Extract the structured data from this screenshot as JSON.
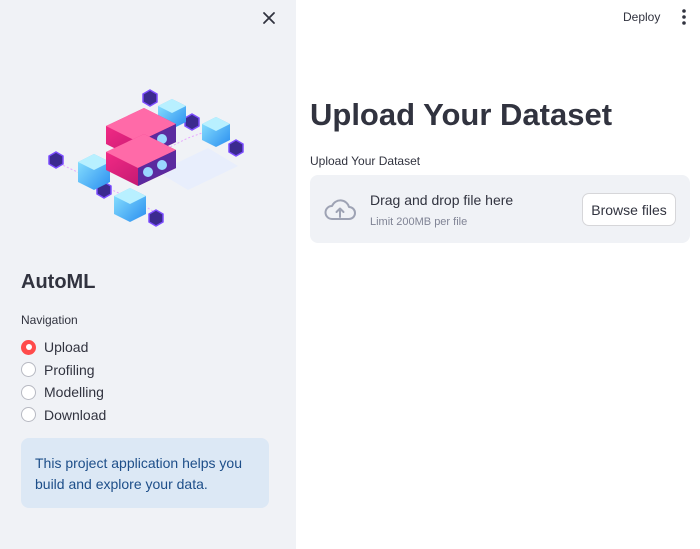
{
  "sidebar": {
    "app_title": "AutoML",
    "nav_label": "Navigation",
    "nav_options": [
      "Upload",
      "Profiling",
      "Modelling",
      "Download"
    ],
    "selected_option": "Upload",
    "info_text": "This project application helps you build and explore your data.",
    "hero_image": "server-blocks-isometric-illustration"
  },
  "header": {
    "deploy_label": "Deploy",
    "menu_icon": "kebab-menu-icon"
  },
  "main": {
    "title": "Upload Your Dataset",
    "uploader": {
      "label": "Upload Your Dataset",
      "drop_text": "Drag and drop file here",
      "limit_text": "Limit 200MB per file",
      "browse_label": "Browse files",
      "icon": "cloud-upload-icon"
    }
  },
  "colors": {
    "accent": "#ff4b4b",
    "sidebar_bg": "#f0f2f6",
    "info_bg": "#dce8f5",
    "info_text": "#1d4e89",
    "text": "#31333f",
    "muted": "#808495"
  }
}
